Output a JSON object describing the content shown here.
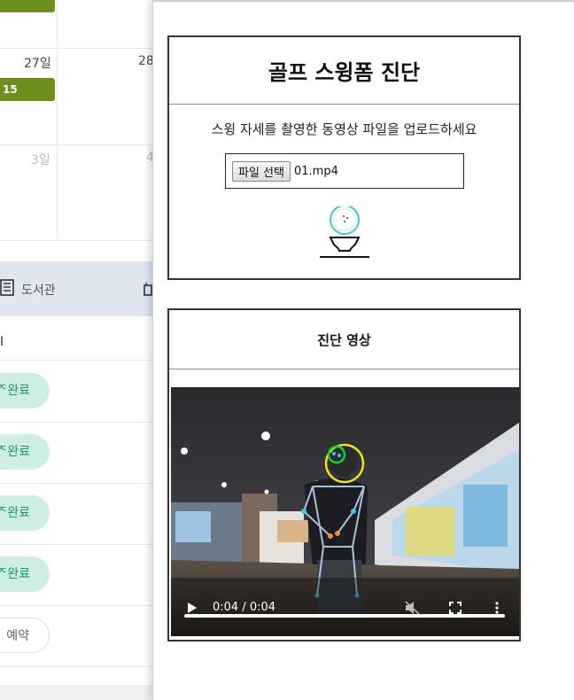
{
  "background": {
    "calendar": {
      "day_27": "27일",
      "day_28": "28",
      "day_3": "3일",
      "day_4": "4",
      "event_label": "15"
    },
    "library": {
      "label": "도서관"
    },
    "list": {
      "first_row_text": "I",
      "status_pills": [
        "ᄌ완료",
        "ᄌ완료",
        "ᄌ완료",
        "ᄌ완료"
      ],
      "reserve_pill": "예약"
    }
  },
  "modal": {
    "upload_card": {
      "title": "골프 스윙폼 진단",
      "description": "스윙 자세를 촬영한 동영상 파일을 업로드하세요",
      "file_button_label": "파일 선택",
      "file_name": "01.mp4",
      "icon": "golf-ball-on-tee-icon"
    },
    "result_card": {
      "title": "진단 영상",
      "video": {
        "time_display": "0:04 / 0:04",
        "progress": 1.0,
        "muted": true,
        "icons": [
          "play-icon",
          "mute-icon",
          "fullscreen-icon",
          "more-options-icon"
        ]
      }
    }
  },
  "colors": {
    "event_green": "#6e8f1f",
    "pill_bg": "#cfeee2",
    "pill_text": "#22946a",
    "library_band": "#dfe6ef",
    "golf_icon_accent": "#3ec6c6",
    "pose_skeleton": "#b8d4e6",
    "head_circle_yellow": "#e8e22a",
    "head_circle_green": "#1ecb3a"
  }
}
